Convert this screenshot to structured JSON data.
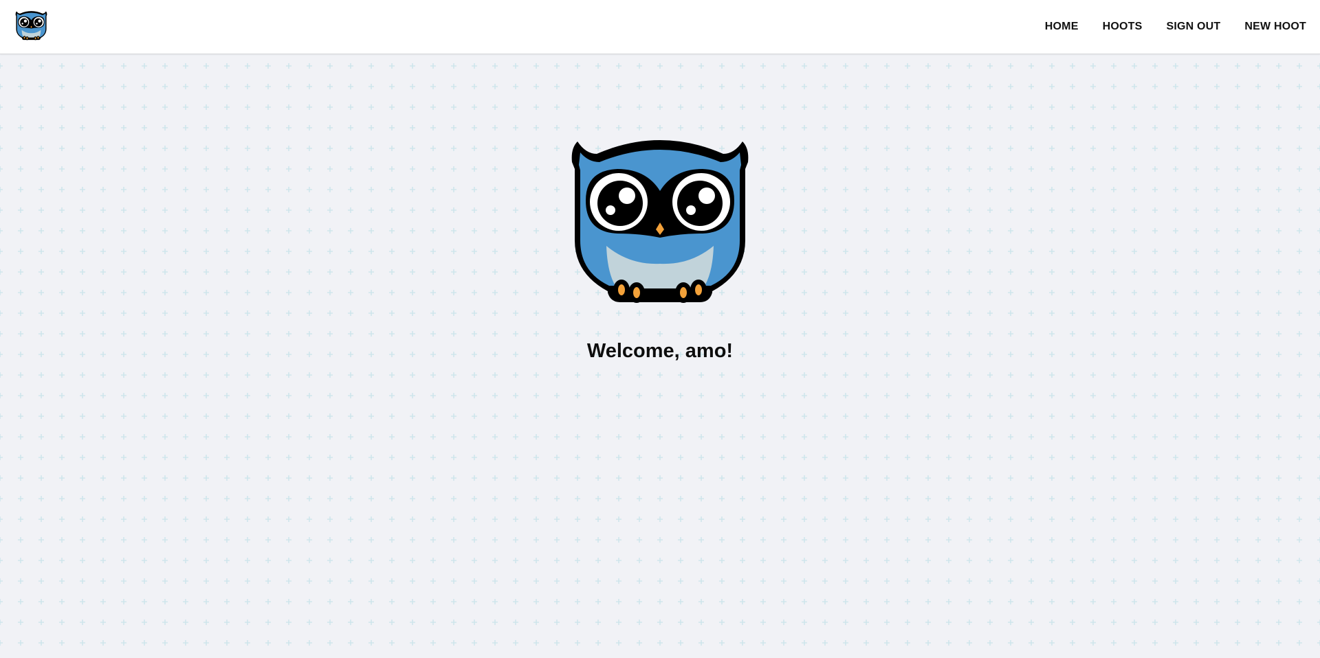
{
  "nav": {
    "logo_icon": "owl-logo-icon",
    "links": [
      {
        "label": "HOME"
      },
      {
        "label": "HOOTS"
      },
      {
        "label": "SIGN OUT"
      },
      {
        "label": "NEW HOOT"
      }
    ]
  },
  "main": {
    "hero_icon": "owl-logo-icon",
    "welcome_text": "Welcome, amo!"
  },
  "colors": {
    "owl_blue": "#4a95cf",
    "owl_belly": "#c1d3da",
    "owl_beak_feet": "#f4a23a",
    "outline": "#000000",
    "background": "#f1f2f6",
    "pattern_plus": "#cfe6ec"
  }
}
